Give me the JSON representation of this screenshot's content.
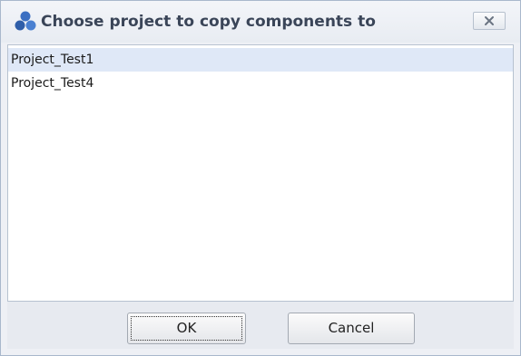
{
  "window": {
    "title": "Choose project to copy components to",
    "icon": "project-cluster-icon",
    "close_icon": "close-icon"
  },
  "projects": {
    "items": [
      {
        "label": "Project_Test1",
        "selected": true
      },
      {
        "label": "Project_Test4",
        "selected": false
      }
    ]
  },
  "buttons": {
    "ok_label": "OK",
    "cancel_label": "Cancel"
  },
  "colors": {
    "title_text": "#3a4558",
    "icon_blue": "#3b6fc2",
    "selection": "#dfe8f7"
  }
}
